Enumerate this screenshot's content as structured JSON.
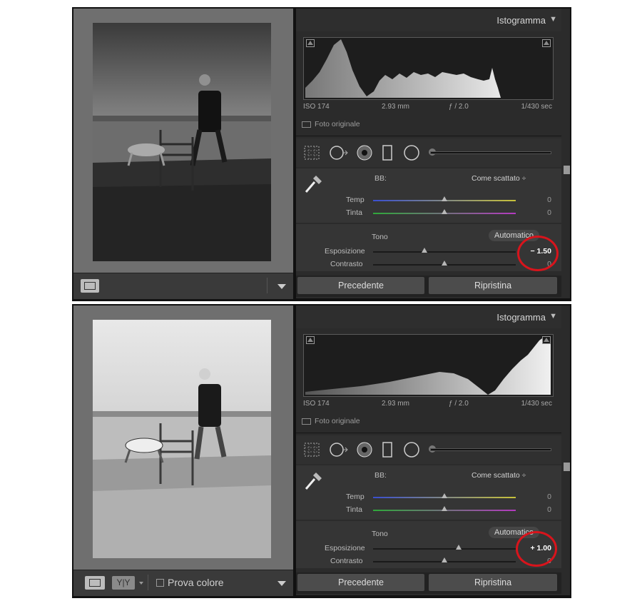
{
  "panels": [
    {
      "histogram_label": "Istogramma",
      "info": {
        "iso": "ISO 174",
        "focal": "2.93 mm",
        "aperture": "ƒ / 2.0",
        "shutter": "1/430 sec"
      },
      "original_photo_label": "Foto originale",
      "wb_label": "BB:",
      "wb_value": "Come scattato ÷",
      "temp_label": "Temp",
      "temp_value": "0",
      "tint_label": "Tinta",
      "tint_value": "0",
      "tone_label": "Tono",
      "auto_label": "Automatico",
      "exposure_label": "Esposizione",
      "exposure_value": "− 1.50",
      "contrast_label": "Contrasto",
      "contrast_value": "0",
      "prev_label": "Precedente",
      "reset_label": "Ripristina",
      "exposure_position": 0.36
    },
    {
      "histogram_label": "Istogramma",
      "info": {
        "iso": "ISO 174",
        "focal": "2.93 mm",
        "aperture": "ƒ / 2.0",
        "shutter": "1/430 sec"
      },
      "original_photo_label": "Foto originale",
      "wb_label": "BB:",
      "wb_value": "Come scattato ÷",
      "temp_label": "Temp",
      "temp_value": "0",
      "tint_label": "Tinta",
      "tint_value": "0",
      "tone_label": "Tono",
      "auto_label": "Automatico",
      "exposure_label": "Esposizione",
      "exposure_value": "+ 1.00",
      "contrast_label": "Contrasto",
      "contrast_value": "0",
      "prev_label": "Precedente",
      "reset_label": "Ripristina",
      "exposure_position": 0.6,
      "toolbar": {
        "proof_label": "Prova colore",
        "compare_label": "Y|Y"
      }
    }
  ],
  "icons": [
    "grid-crop-icon",
    "spot-removal-icon",
    "red-eye-icon",
    "graduated-filter-icon",
    "radial-filter-icon",
    "brush-icon",
    "eyedropper-icon",
    "loupe-view-icon",
    "dropdown-arrow-icon"
  ],
  "colors": {
    "highlight_circle": "#d8141c"
  }
}
